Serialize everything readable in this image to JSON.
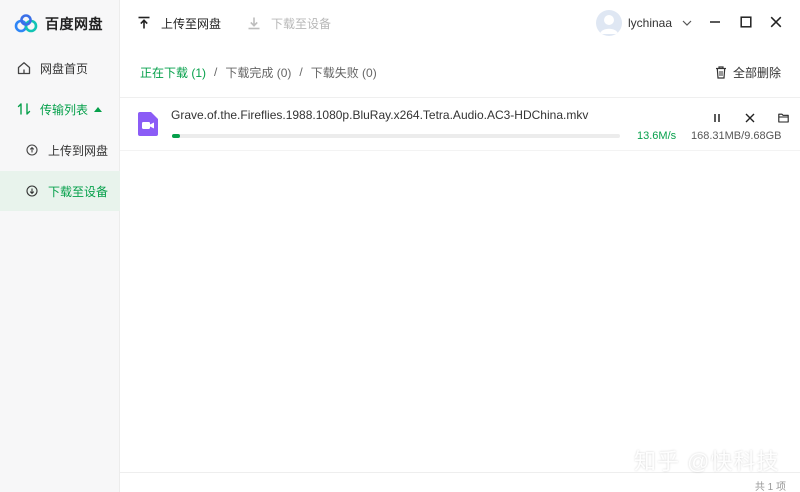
{
  "app": {
    "name": "百度网盘",
    "accent": "#06a04b"
  },
  "sidebar": {
    "home_label": "网盘首页",
    "transfer_label": "传输列表",
    "upload_label": "上传到网盘",
    "download_label": "下载至设备"
  },
  "toolbar": {
    "upload_label": "上传至网盘",
    "download_label": "下载至设备",
    "username": "lychinaa"
  },
  "filters": {
    "in_progress": "正在下载 (1)",
    "completed": "下载完成 (0)",
    "failed": "下载失败 (0)",
    "separator": "/",
    "delete_all": "全部删除"
  },
  "downloads": [
    {
      "file_name": "Grave.of.the.Fireflies.1988.1080p.BluRay.x264.Tetra.Audio.AC3-HDChina.mkv",
      "speed": "13.6M/s",
      "size": "168.31MB/9.68GB",
      "progress": 0.017,
      "icon": "video-file-icon"
    }
  ],
  "footer": {
    "count": "共 1 项"
  },
  "watermark": "知乎 @快科技"
}
